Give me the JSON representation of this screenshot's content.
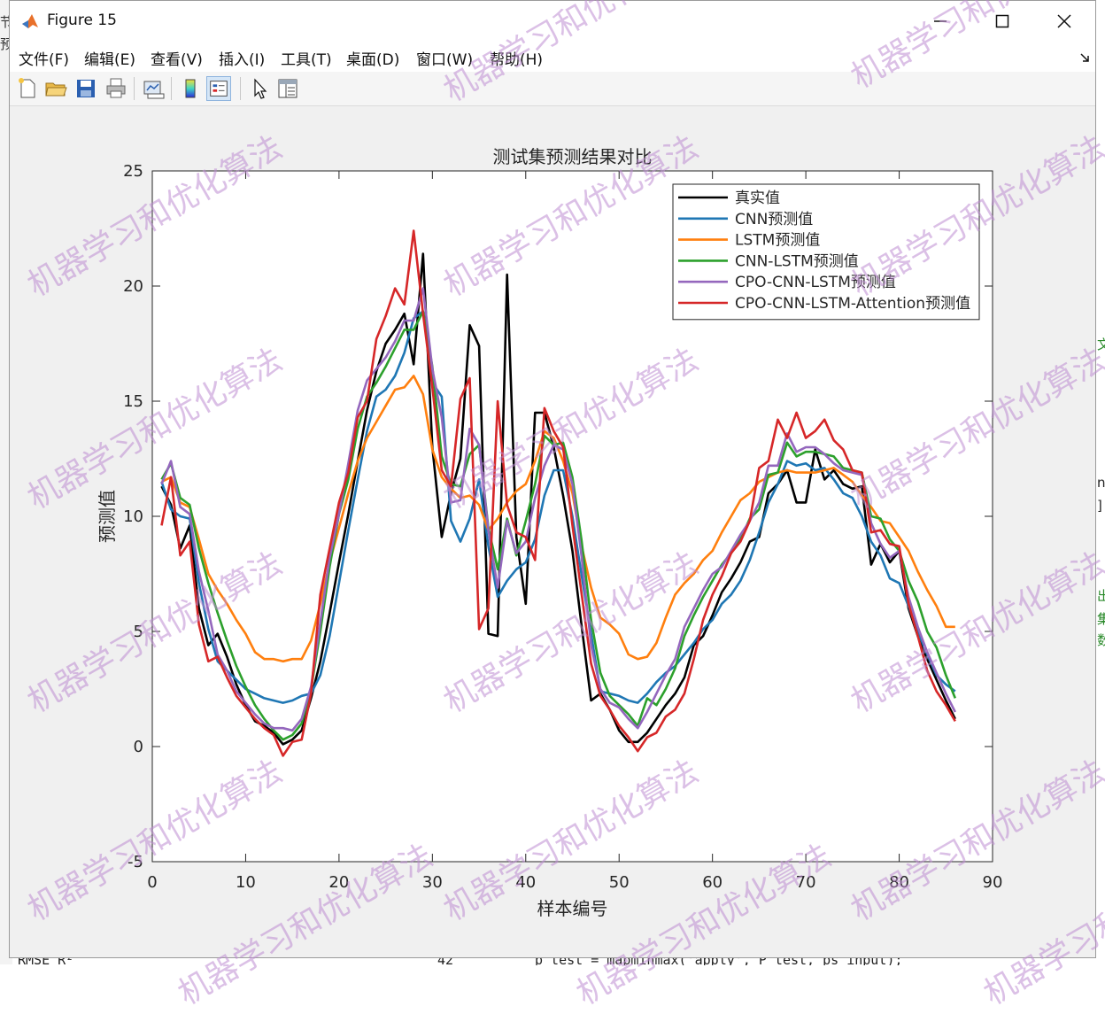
{
  "window": {
    "title": "Figure 15"
  },
  "menu": [
    "文件(F)",
    "编辑(E)",
    "查看(V)",
    "插入(I)",
    "工具(T)",
    "桌面(D)",
    "窗口(W)",
    "帮助(H)"
  ],
  "toolbar_icons": [
    "new-figure-icon",
    "open-file-icon",
    "save-icon",
    "print-icon",
    "link-plot-icon",
    "insert-colorbar-icon",
    "insert-legend-icon",
    "pointer-icon",
    "property-inspector-icon"
  ],
  "watermark": "机器学习和优化算法",
  "background": {
    "left_chars": [
      "节",
      "预"
    ],
    "right_chars": [
      "文",
      "n",
      "]",
      "出",
      "集",
      "数"
    ],
    "bottom_left": "RMSE       R²",
    "bottom_mid": "42",
    "bottom_right": "p_test = mapminmax('apply', P_test, ps_input);"
  },
  "chart_data": {
    "type": "line",
    "title": "测试集预测结果对比",
    "xlabel": "样本编号",
    "ylabel": "预测值",
    "xlim": [
      0,
      90
    ],
    "ylim": [
      -5,
      25
    ],
    "xticks": [
      0,
      10,
      20,
      30,
      40,
      50,
      60,
      70,
      80,
      90
    ],
    "yticks": [
      -5,
      0,
      5,
      10,
      15,
      20,
      25
    ],
    "grid": false,
    "legend_position": "top-right",
    "x": [
      1,
      2,
      3,
      4,
      5,
      6,
      7,
      8,
      9,
      10,
      11,
      12,
      13,
      14,
      15,
      16,
      17,
      18,
      19,
      20,
      21,
      22,
      23,
      24,
      25,
      26,
      27,
      28,
      29,
      30,
      31,
      32,
      33,
      34,
      35,
      36,
      37,
      38,
      39,
      40,
      41,
      42,
      43,
      44,
      45,
      46,
      47,
      48,
      49,
      50,
      51,
      52,
      53,
      54,
      55,
      56,
      57,
      58,
      59,
      60,
      61,
      62,
      63,
      64,
      65,
      66,
      67,
      68,
      69,
      70,
      71,
      72,
      73,
      74,
      75,
      76,
      77,
      78,
      79,
      80,
      81,
      82,
      83,
      84,
      85,
      86
    ],
    "series": [
      {
        "name": "真实值",
        "color": "#000000",
        "values": [
          11.3,
          10.5,
          8.6,
          9.6,
          6.0,
          4.4,
          4.9,
          3.9,
          2.7,
          1.8,
          1.1,
          0.9,
          0.6,
          0.1,
          0.3,
          0.7,
          2.1,
          3.7,
          5.8,
          8.0,
          10.1,
          12.4,
          14.6,
          16.3,
          17.5,
          18.1,
          18.8,
          16.6,
          21.4,
          13.0,
          9.1,
          11.0,
          12.5,
          18.3,
          17.4,
          4.9,
          4.8,
          20.5,
          9.1,
          6.2,
          14.5,
          14.5,
          13.0,
          10.9,
          8.5,
          5.2,
          2.0,
          2.3,
          1.6,
          0.7,
          0.2,
          0.2,
          0.6,
          1.2,
          1.8,
          2.3,
          3.0,
          4.4,
          4.8,
          5.7,
          6.7,
          7.3,
          8.0,
          8.9,
          9.1,
          11.0,
          11.4,
          12.0,
          10.6,
          10.6,
          12.9,
          11.6,
          12.0,
          11.4,
          11.2,
          11.3,
          7.9,
          8.8,
          8.0,
          8.5,
          6.0,
          4.8,
          3.8,
          2.9,
          2.0,
          1.2
        ]
      },
      {
        "name": "CNN预测值",
        "color": "#1f77b4",
        "values": [
          11.5,
          10.3,
          10.0,
          9.9,
          7.1,
          5.1,
          3.7,
          3.3,
          2.9,
          2.5,
          2.3,
          2.1,
          2.0,
          1.9,
          2.0,
          2.2,
          2.3,
          3.1,
          4.8,
          7.1,
          9.4,
          11.6,
          13.7,
          15.2,
          15.5,
          16.1,
          17.1,
          18.6,
          18.9,
          15.8,
          15.2,
          9.8,
          8.9,
          9.9,
          11.6,
          8.7,
          6.5,
          7.2,
          7.7,
          8.0,
          9.0,
          10.9,
          12.0,
          12.0,
          10.0,
          7.4,
          4.9,
          2.4,
          2.3,
          2.2,
          2.0,
          1.9,
          2.3,
          2.8,
          3.2,
          3.5,
          4.0,
          4.5,
          5.1,
          5.5,
          6.2,
          6.6,
          7.2,
          8.1,
          9.3,
          10.6,
          11.4,
          12.4,
          12.2,
          12.3,
          12.0,
          12.1,
          11.6,
          11.0,
          10.8,
          10.0,
          8.9,
          8.3,
          7.3,
          7.1,
          6.1,
          5.0,
          4.0,
          3.1,
          2.7,
          2.4
        ]
      },
      {
        "name": "LSTM预测值",
        "color": "#ff7f0e",
        "values": [
          11.5,
          11.7,
          10.6,
          10.4,
          9.0,
          7.5,
          6.8,
          6.2,
          5.5,
          4.9,
          4.1,
          3.8,
          3.8,
          3.7,
          3.8,
          3.8,
          4.6,
          6.2,
          8.0,
          9.5,
          11.0,
          12.4,
          13.4,
          14.1,
          14.8,
          15.5,
          15.6,
          16.1,
          15.3,
          12.9,
          11.7,
          11.2,
          10.8,
          10.9,
          10.5,
          9.4,
          9.9,
          10.6,
          11.1,
          11.4,
          12.4,
          13.7,
          13.4,
          12.4,
          11.0,
          8.7,
          6.9,
          5.6,
          5.3,
          4.9,
          4.0,
          3.8,
          3.9,
          4.5,
          5.6,
          6.6,
          7.1,
          7.5,
          8.1,
          8.5,
          9.3,
          10.0,
          10.7,
          11.0,
          11.5,
          11.7,
          11.9,
          12.0,
          11.9,
          11.9,
          11.9,
          12.0,
          12.1,
          11.8,
          11.5,
          10.9,
          10.4,
          9.8,
          9.7,
          9.1,
          8.5,
          7.6,
          6.8,
          6.1,
          5.2,
          5.2
        ]
      },
      {
        "name": "CNN-LSTM预测值",
        "color": "#2ca02c",
        "values": [
          11.6,
          12.3,
          10.8,
          10.5,
          8.6,
          7.1,
          5.8,
          4.6,
          3.5,
          2.6,
          1.8,
          1.2,
          0.7,
          0.3,
          0.5,
          1.0,
          2.5,
          5.0,
          7.8,
          10.1,
          11.6,
          13.8,
          15.2,
          15.8,
          16.5,
          17.3,
          18.1,
          18.1,
          18.9,
          16.5,
          12.6,
          11.4,
          11.3,
          12.7,
          13.1,
          9.5,
          7.7,
          9.9,
          8.3,
          9.8,
          11.4,
          13.5,
          13.1,
          13.2,
          11.7,
          8.9,
          5.5,
          3.2,
          2.2,
          1.8,
          1.4,
          0.9,
          2.1,
          1.8,
          2.5,
          3.4,
          4.8,
          5.7,
          6.5,
          7.2,
          7.9,
          8.4,
          9.0,
          9.9,
          10.3,
          11.8,
          11.9,
          13.2,
          12.6,
          12.8,
          12.8,
          12.7,
          12.6,
          12.1,
          12.0,
          11.9,
          10.0,
          9.9,
          9.0,
          8.5,
          7.2,
          6.3,
          5.0,
          4.3,
          3.1,
          2.1
        ]
      },
      {
        "name": "CPO-CNN-LSTM预测值",
        "color": "#9467bd",
        "values": [
          11.4,
          12.4,
          10.4,
          10.1,
          7.6,
          5.9,
          4.0,
          3.3,
          2.4,
          1.9,
          1.4,
          1.0,
          0.8,
          0.8,
          0.7,
          1.2,
          2.6,
          5.4,
          8.2,
          10.1,
          12.3,
          14.6,
          15.9,
          16.4,
          16.9,
          17.6,
          18.5,
          18.5,
          19.9,
          16.4,
          14.3,
          10.6,
          10.7,
          13.8,
          13.1,
          9.4,
          6.9,
          9.8,
          8.4,
          8.9,
          10.8,
          12.2,
          13.1,
          12.9,
          11.4,
          8.2,
          4.4,
          2.5,
          1.9,
          1.7,
          1.2,
          0.8,
          1.5,
          2.3,
          3.1,
          3.8,
          5.2,
          6.0,
          6.8,
          7.5,
          7.8,
          8.5,
          9.2,
          9.8,
          10.6,
          12.2,
          12.2,
          13.6,
          12.8,
          13.0,
          13.0,
          12.7,
          12.3,
          12.0,
          11.9,
          11.8,
          9.7,
          8.8,
          8.2,
          8.5,
          6.5,
          5.2,
          4.1,
          3.2,
          2.3,
          1.5
        ]
      },
      {
        "name": "CPO-CNN-LSTM-Attention预测值",
        "color": "#d62728",
        "values": [
          9.6,
          11.7,
          8.3,
          8.9,
          5.3,
          3.7,
          3.9,
          3.0,
          2.2,
          1.7,
          1.2,
          0.8,
          0.5,
          -0.4,
          0.2,
          0.3,
          2.3,
          6.6,
          8.6,
          10.6,
          11.9,
          14.3,
          15.0,
          17.7,
          18.7,
          19.9,
          19.2,
          22.4,
          18.8,
          15.6,
          12.0,
          11.3,
          15.1,
          16.0,
          5.1,
          6.0,
          15.0,
          10.5,
          9.3,
          9.1,
          8.1,
          14.7,
          13.7,
          13.0,
          9.6,
          6.6,
          3.6,
          2.2,
          1.6,
          0.9,
          0.4,
          -0.2,
          0.4,
          0.6,
          1.3,
          1.6,
          2.3,
          3.8,
          5.5,
          6.6,
          7.4,
          8.4,
          8.9,
          9.8,
          12.1,
          12.4,
          14.2,
          13.4,
          14.5,
          13.4,
          13.7,
          14.2,
          13.3,
          12.9,
          12.0,
          11.9,
          9.3,
          9.4,
          8.8,
          8.7,
          6.2,
          4.8,
          3.3,
          2.4,
          1.8,
          1.1
        ]
      }
    ]
  }
}
